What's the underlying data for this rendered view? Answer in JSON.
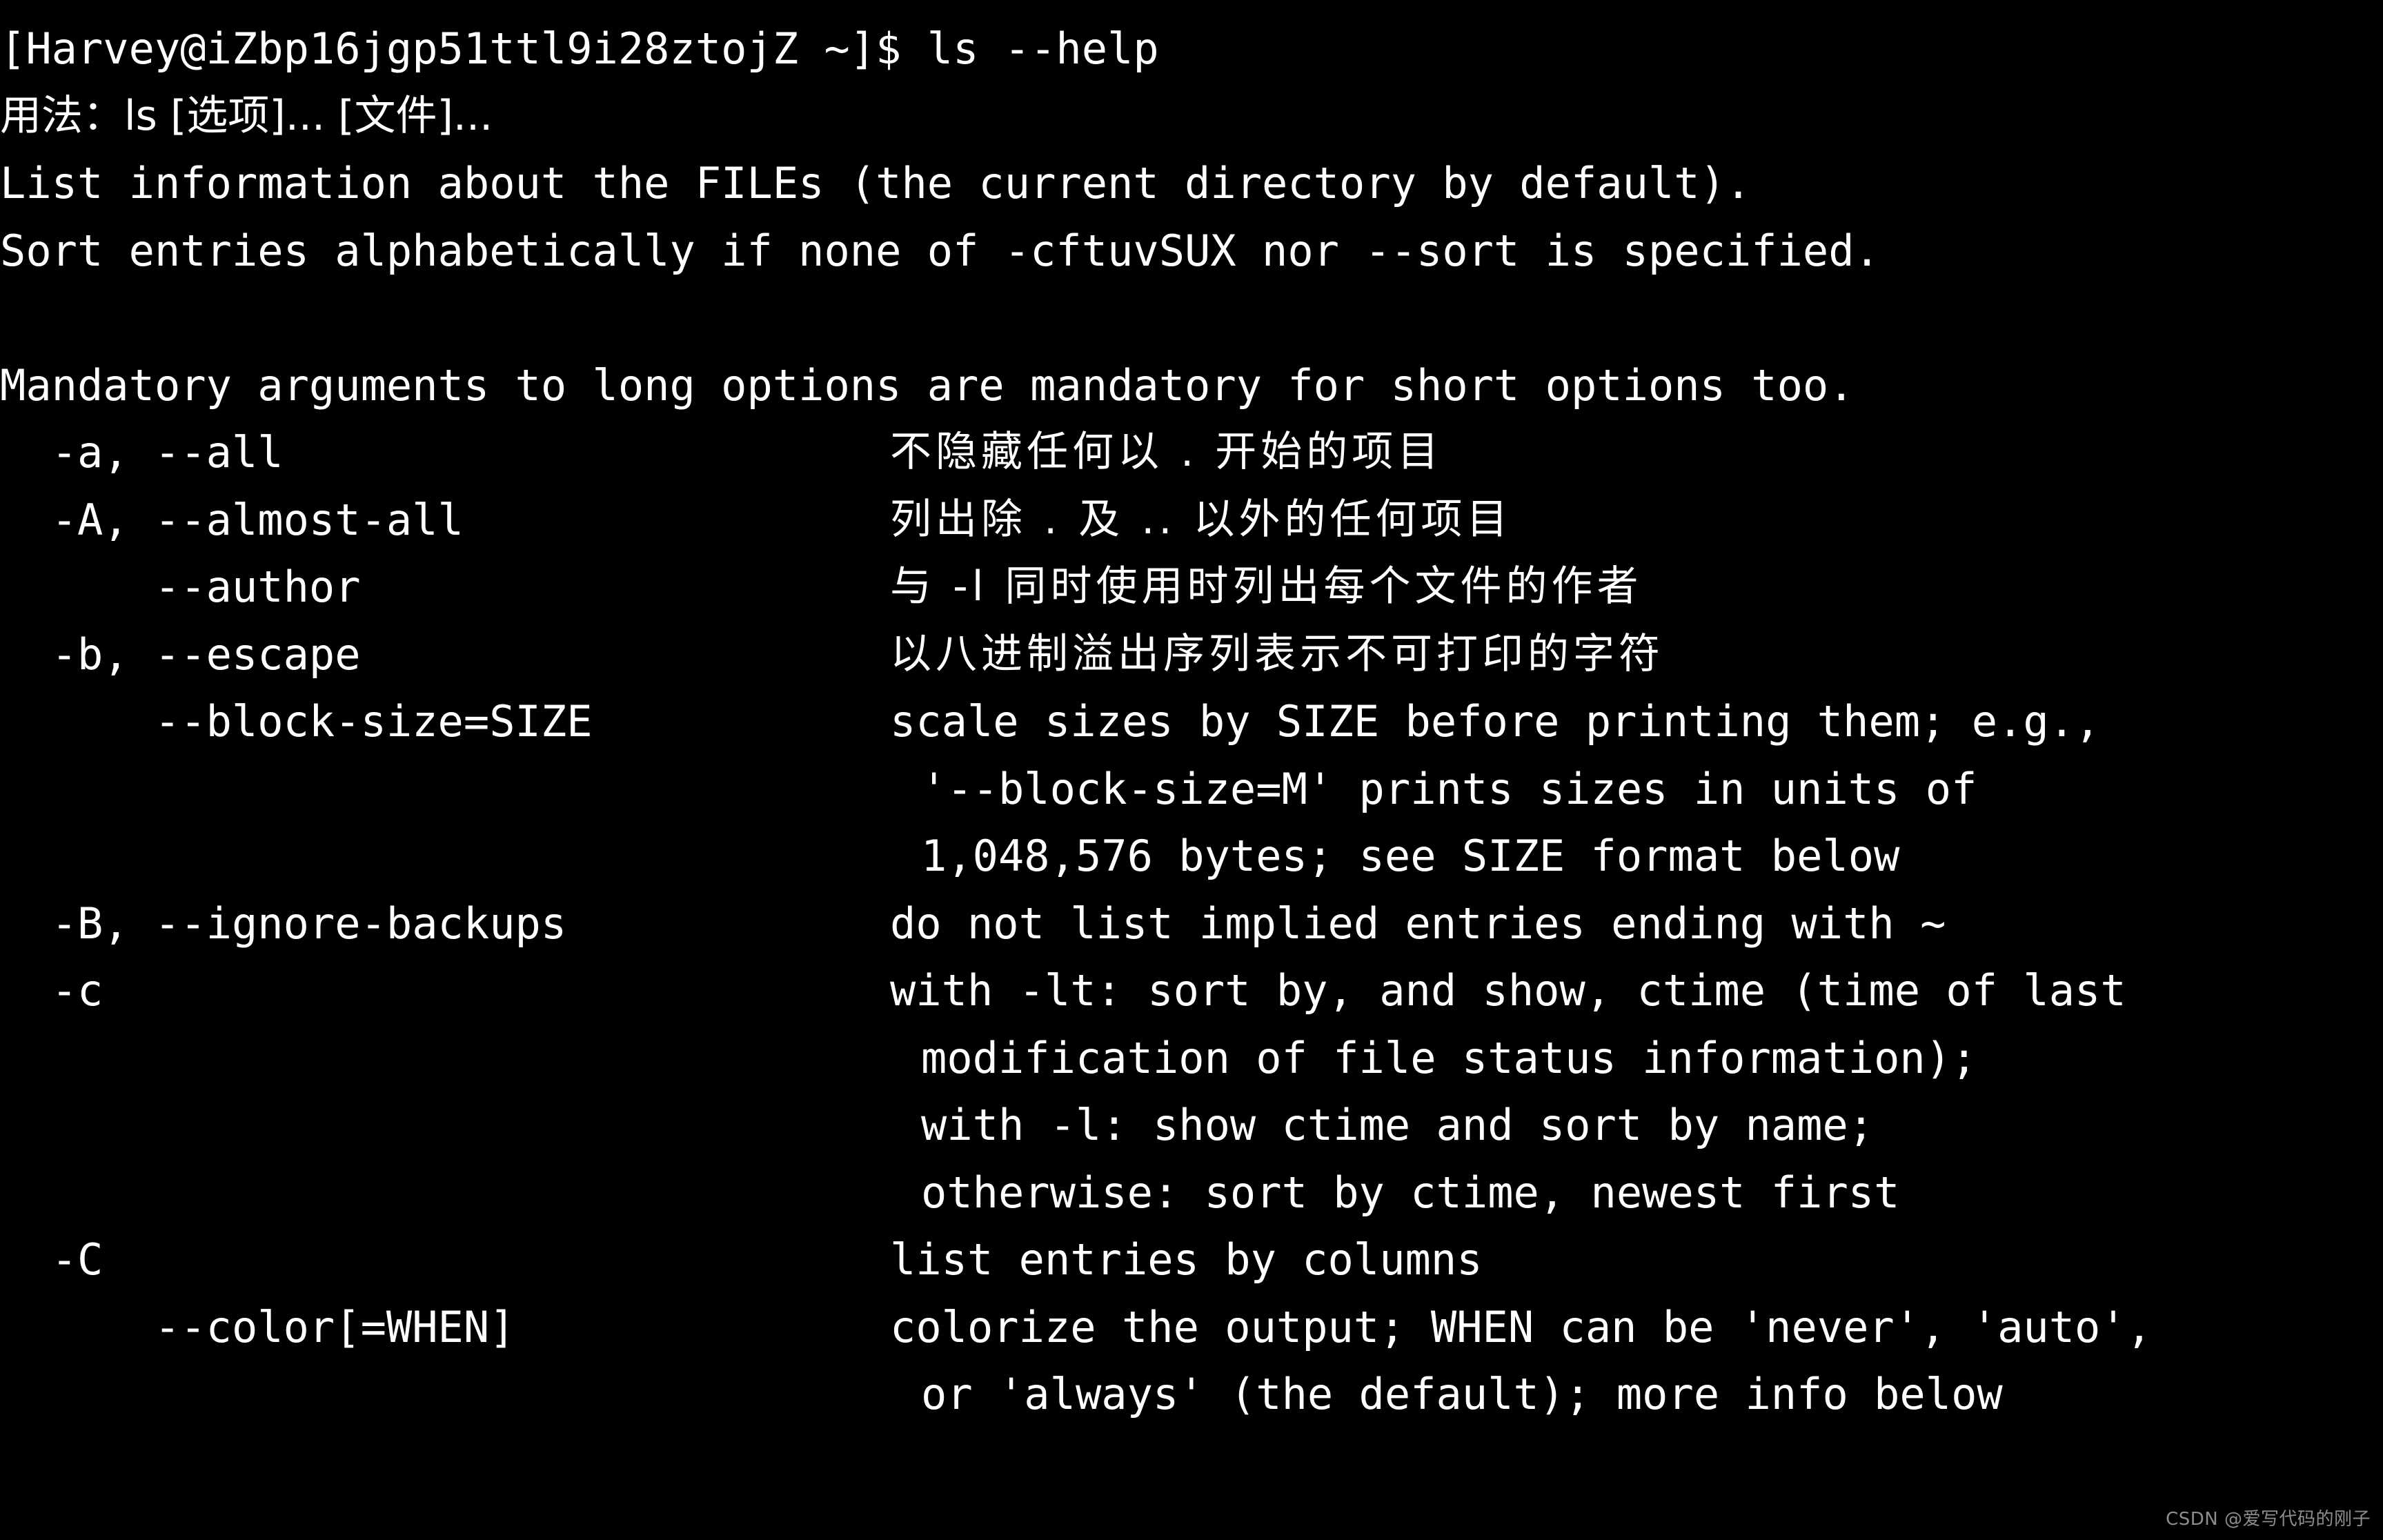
{
  "terminal": {
    "background_color": "#000000",
    "foreground_color": "#ffffff",
    "prompt_line": "[Harvey@iZbp16jgp51ttl9i28ztojZ ~]$ ls --help",
    "usage_line": "用法：ls [选项]... [文件]...",
    "description_line_1": "List information about the FILEs (the current directory by default).",
    "description_line_2": "Sort entries alphabetically if none of -cftuvSUX nor --sort is specified.",
    "blank_line": "",
    "mandatory_note": "Mandatory arguments to long options are mandatory for short options too."
  },
  "options": [
    {
      "flags": "  -a, --all",
      "desc": "不隐藏任何以 . 开始的项目",
      "lang": "cjk",
      "continuations": []
    },
    {
      "flags": "  -A, --almost-all",
      "desc": "列出除 . 及 .. 以外的任何项目",
      "lang": "cjk",
      "continuations": []
    },
    {
      "flags": "      --author",
      "desc": "与 -l 同时使用时列出每个文件的作者",
      "lang": "cjk",
      "continuations": []
    },
    {
      "flags": "  -b, --escape",
      "desc": "以八进制溢出序列表示不可打印的字符",
      "lang": "cjk",
      "continuations": []
    },
    {
      "flags": "      --block-size=SIZE",
      "desc": "scale sizes by SIZE before printing them; e.g.,",
      "lang": "latin",
      "continuations": [
        "'--block-size=M' prints sizes in units of",
        "1,048,576 bytes; see SIZE format below"
      ]
    },
    {
      "flags": "  -B, --ignore-backups",
      "desc": "do not list implied entries ending with ~",
      "lang": "latin",
      "continuations": []
    },
    {
      "flags": "  -c",
      "desc": "with -lt: sort by, and show, ctime (time of last",
      "lang": "latin",
      "continuations": [
        "modification of file status information);",
        "with -l: show ctime and sort by name;",
        "otherwise: sort by ctime, newest first"
      ]
    },
    {
      "flags": "  -C",
      "desc": "list entries by columns",
      "lang": "latin",
      "continuations": []
    },
    {
      "flags": "      --color[=WHEN]",
      "desc": "colorize the output; WHEN can be 'never', 'auto',",
      "lang": "latin",
      "continuations": [
        "or 'always' (the default); more info below"
      ]
    }
  ],
  "watermark": {
    "text": "CSDN @爱写代码的刚子",
    "color": "#8d8d8d"
  }
}
